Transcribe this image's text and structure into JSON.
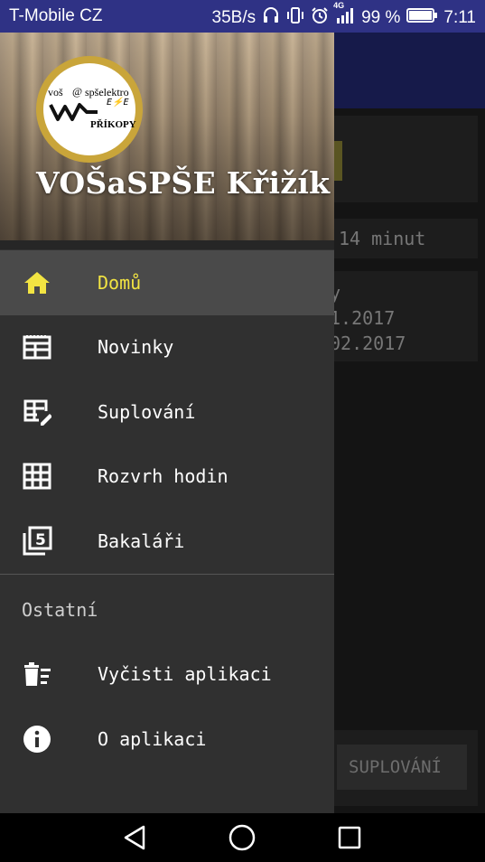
{
  "status_bar": {
    "carrier": "T-Mobile CZ",
    "speed": "35B/s",
    "network": "4G",
    "battery": "99 %",
    "time": "7:11"
  },
  "background": {
    "timer_text": "14 minut",
    "lines": [
      "y",
      "1.2017",
      "02.2017"
    ],
    "button_label": "SUPLOVÁNÍ"
  },
  "drawer": {
    "school_name": "VOŠaSPŠE Křižík",
    "logo": {
      "line1": "voš",
      "line2": "spšelektro",
      "line3": "PŘÍKOPY"
    },
    "items": [
      {
        "label": "Domů",
        "icon": "home-icon",
        "active": true
      },
      {
        "label": "Novinky",
        "icon": "news-icon",
        "active": false
      },
      {
        "label": "Suplování",
        "icon": "substitution-icon",
        "active": false
      },
      {
        "label": "Rozvrh hodin",
        "icon": "timetable-icon",
        "active": false
      },
      {
        "label": "Bakaláři",
        "icon": "bakalari-icon",
        "active": false
      }
    ],
    "section_title": "Ostatní",
    "other_items": [
      {
        "label": "Vyčisti aplikaci",
        "icon": "clear-app-icon"
      },
      {
        "label": "O aplikaci",
        "icon": "info-icon"
      }
    ]
  },
  "colors": {
    "status_bar": "#2f3285",
    "active_accent": "#f2e442",
    "drawer_bg": "#303030"
  }
}
